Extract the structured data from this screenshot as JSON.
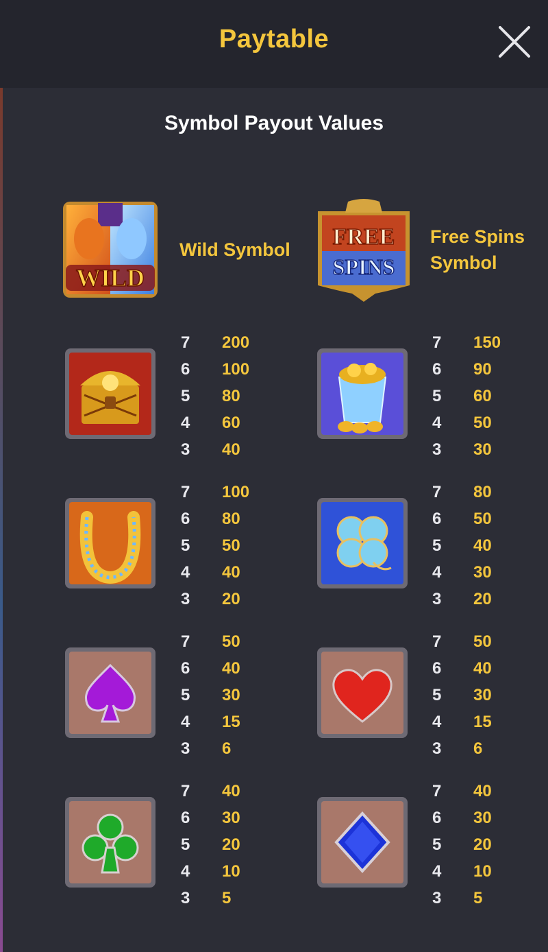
{
  "header": {
    "title": "Paytable",
    "close_icon": "close-icon"
  },
  "section_title": "Symbol Payout Values",
  "special_symbols": [
    {
      "name": "wild",
      "label_lines": [
        "Wild Symbol"
      ],
      "icon_text": "WILD"
    },
    {
      "name": "free-spins",
      "label_lines": [
        "Free Spins",
        "Symbol"
      ],
      "icon_text_top": "FREE",
      "icon_text_bottom": "SPINS"
    }
  ],
  "symbols": [
    {
      "name": "treasure-chest",
      "icon": "treasure-chest-icon",
      "pays": [
        [
          "7",
          "200"
        ],
        [
          "6",
          "100"
        ],
        [
          "5",
          "80"
        ],
        [
          "4",
          "60"
        ],
        [
          "3",
          "40"
        ]
      ]
    },
    {
      "name": "gold-pot",
      "icon": "gold-pot-icon",
      "pays": [
        [
          "7",
          "150"
        ],
        [
          "6",
          "90"
        ],
        [
          "5",
          "60"
        ],
        [
          "4",
          "50"
        ],
        [
          "3",
          "30"
        ]
      ]
    },
    {
      "name": "horseshoe",
      "icon": "horseshoe-icon",
      "pays": [
        [
          "7",
          "100"
        ],
        [
          "6",
          "80"
        ],
        [
          "5",
          "50"
        ],
        [
          "4",
          "40"
        ],
        [
          "3",
          "20"
        ]
      ]
    },
    {
      "name": "clover",
      "icon": "four-leaf-clover-icon",
      "pays": [
        [
          "7",
          "80"
        ],
        [
          "6",
          "50"
        ],
        [
          "5",
          "40"
        ],
        [
          "4",
          "30"
        ],
        [
          "3",
          "20"
        ]
      ]
    },
    {
      "name": "spade",
      "icon": "spade-icon",
      "pays": [
        [
          "7",
          "50"
        ],
        [
          "6",
          "40"
        ],
        [
          "5",
          "30"
        ],
        [
          "4",
          "15"
        ],
        [
          "3",
          "6"
        ]
      ]
    },
    {
      "name": "heart",
      "icon": "heart-icon",
      "pays": [
        [
          "7",
          "50"
        ],
        [
          "6",
          "40"
        ],
        [
          "5",
          "30"
        ],
        [
          "4",
          "15"
        ],
        [
          "3",
          "6"
        ]
      ]
    },
    {
      "name": "club",
      "icon": "club-icon",
      "pays": [
        [
          "7",
          "40"
        ],
        [
          "6",
          "30"
        ],
        [
          "5",
          "20"
        ],
        [
          "4",
          "10"
        ],
        [
          "3",
          "5"
        ]
      ]
    },
    {
      "name": "diamond",
      "icon": "diamond-icon",
      "pays": [
        [
          "7",
          "40"
        ],
        [
          "6",
          "30"
        ],
        [
          "5",
          "20"
        ],
        [
          "4",
          "10"
        ],
        [
          "3",
          "5"
        ]
      ]
    }
  ],
  "colors": {
    "background": "#2c2d36",
    "header": "#24252d",
    "accent_gold": "#f4c63d",
    "count_text": "#e9e9ee"
  }
}
